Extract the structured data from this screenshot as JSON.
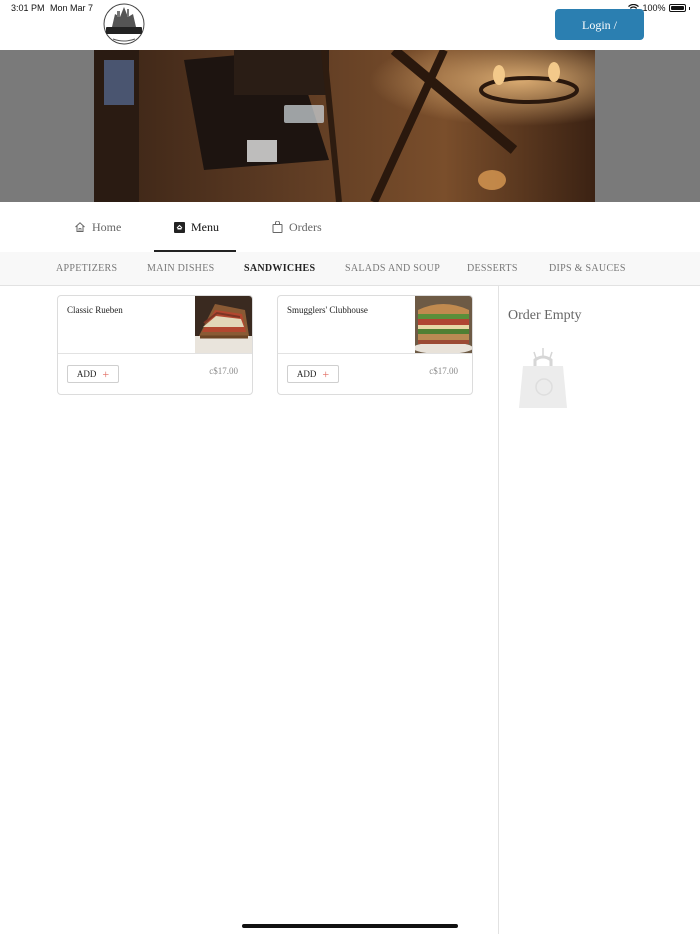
{
  "status_bar": {
    "time": "3:01 PM",
    "date": "Mon Mar 7",
    "battery": "100%"
  },
  "header": {
    "logo_icon": "smugglers-logo",
    "login_label": "Login / Register",
    "accent": "#2b7fb1"
  },
  "hero": {
    "image": "pub-interior-photo"
  },
  "nav": {
    "tabs": [
      {
        "label": "Home",
        "icon": "home-icon"
      },
      {
        "label": "Menu",
        "icon": "menu-icon"
      },
      {
        "label": "Orders",
        "icon": "bag-icon"
      }
    ],
    "active": "Menu"
  },
  "categories": {
    "items": [
      "APPETIZERS",
      "MAIN DISHES",
      "SANDWICHES",
      "SALADS AND SOUP",
      "DESSERTS",
      "DIPS & SAUCES"
    ],
    "active": "SANDWICHES"
  },
  "products": [
    {
      "name": "Classic Rueben",
      "price": "c$17.00",
      "add_label": "ADD",
      "image": "reuben-sandwich-photo"
    },
    {
      "name": "Smugglers' Clubhouse",
      "price": "c$17.00",
      "add_label": "ADD",
      "image": "clubhouse-sandwich-photo"
    }
  ],
  "order": {
    "title": "Order Empty",
    "icon": "empty-bag-icon"
  }
}
